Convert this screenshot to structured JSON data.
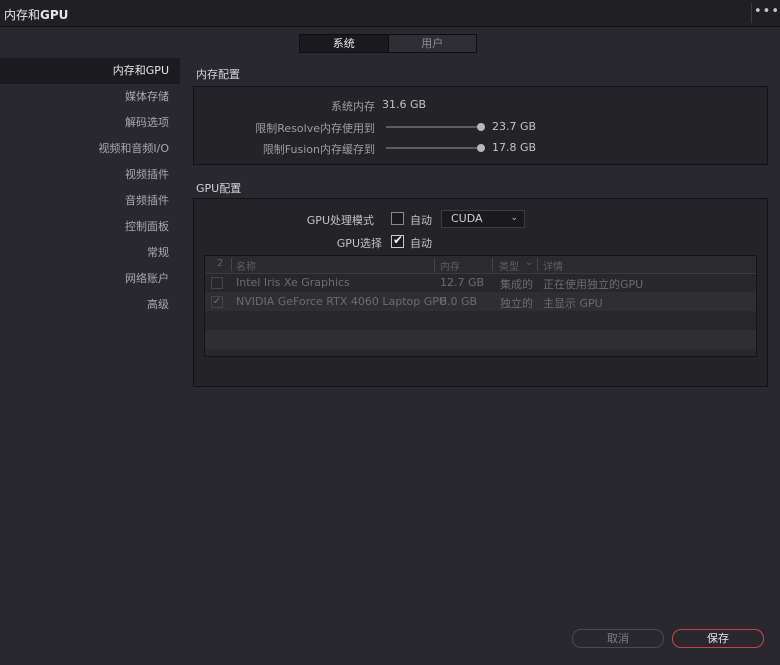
{
  "window": {
    "title_prefix": "内存和",
    "title_bold": "GPU",
    "more_glyph": "•••"
  },
  "tabs": [
    {
      "label": "系统",
      "active": true
    },
    {
      "label": "用户",
      "active": false
    }
  ],
  "sidebar": {
    "items": [
      {
        "label": "内存和GPU",
        "active": true
      },
      {
        "label": "媒体存储"
      },
      {
        "label": "解码选项"
      },
      {
        "label": "视频和音频I/O"
      },
      {
        "label": "视频插件"
      },
      {
        "label": "音频插件"
      },
      {
        "label": "控制面板"
      },
      {
        "label": "常规"
      },
      {
        "label": "网络账户"
      },
      {
        "label": "高级"
      }
    ]
  },
  "memory": {
    "title": "内存配置",
    "system_memory_label": "系统内存",
    "system_memory_value": "31.6 GB",
    "resolve_limit_label": "限制Resolve内存使用到",
    "resolve_limit_value": "23.7 GB",
    "resolve_limit_fraction": 1.0,
    "fusion_limit_label": "限制Fusion内存缓存到",
    "fusion_limit_value": "17.8 GB",
    "fusion_limit_fraction": 1.0
  },
  "gpu": {
    "title": "GPU配置",
    "mode_label": "GPU处理模式",
    "mode_auto_label": "自动",
    "mode_auto_checked": false,
    "mode_value": "CUDA",
    "select_label": "GPU选择",
    "select_auto_label": "自动",
    "select_auto_checked": true,
    "table": {
      "columns": [
        "2",
        "名称",
        "内存",
        "类型",
        "详情"
      ],
      "rows": [
        {
          "checked": false,
          "name": "Intel Iris Xe Graphics",
          "memory": "12.7 GB",
          "type": "集成的",
          "detail": "正在使用独立的GPU"
        },
        {
          "checked": true,
          "name": "NVIDIA GeForce RTX 4060 Laptop GPU",
          "memory": "8.0 GB",
          "type": "独立的",
          "detail": "主显示 GPU"
        }
      ]
    }
  },
  "footer": {
    "cancel_label": "取消",
    "save_label": "保存"
  },
  "colors": {
    "background": "#28282e",
    "panel": "#232328",
    "save_border": "#c74548"
  }
}
